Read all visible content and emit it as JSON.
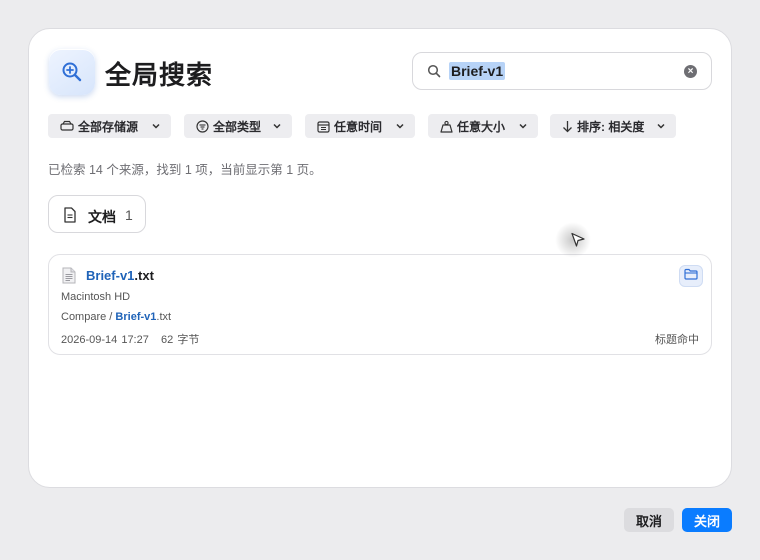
{
  "header": {
    "title": "全局搜索"
  },
  "search": {
    "query": "Brief-v1"
  },
  "filters": [
    {
      "label": "全部存储源",
      "icon": "drive-icon"
    },
    {
      "label": "全部类型",
      "icon": "filter-icon"
    },
    {
      "label": "任意时间",
      "icon": "calendar-icon"
    },
    {
      "label": "任意大小",
      "icon": "weight-icon"
    },
    {
      "label": "排序: 相关度",
      "icon": "sort-arrow-icon"
    }
  ],
  "summary": "已检索 14 个来源，找到 1 项，当前显示第 1 页。",
  "tabs": [
    {
      "label": "文档",
      "count": "1"
    }
  ],
  "results": [
    {
      "name_match": "Brief-v1",
      "name_rest": ".txt",
      "volume": "Macintosh HD",
      "path_prefix": "Compare / ",
      "path_match": "Brief-v1",
      "path_rest": ".txt",
      "date": "2026-09-14 17:27",
      "size": "62 字节",
      "match_type": "标题命中"
    }
  ],
  "footer": {
    "cancel_label": "取消",
    "close_label": "关闭"
  },
  "colors": {
    "accent": "#0a7cff",
    "highlight": "#1f63b8",
    "selection": "#b7d3f7"
  }
}
